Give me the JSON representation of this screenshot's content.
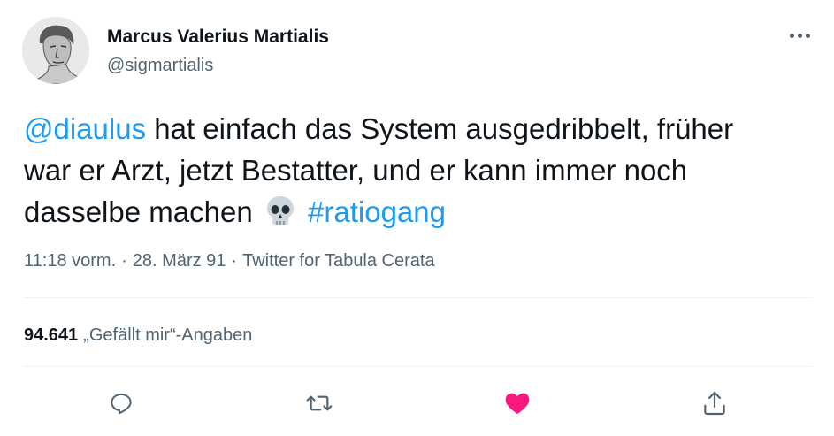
{
  "author": {
    "name": "Marcus Valerius Martialis",
    "handle": "@sigmartialis"
  },
  "tweet": {
    "mention": "@diaulus",
    "text_line1": " hat einfach das System ausgedribbelt, früher",
    "text_line2": "war er Arzt, jetzt Bestatter, und er kann immer noch",
    "text_line3": "dasselbe machen",
    "emoji": "skull-icon",
    "hashtag": "#ratiogang"
  },
  "meta": {
    "time": "11:18 vorm.",
    "date": "28. März 91",
    "source": "Twitter for Tabula Cerata",
    "separator": "·"
  },
  "stats": {
    "likes_count": "94.641",
    "likes_label": "„Gefällt mir“-Angaben"
  },
  "actions": {
    "reply": "reply-icon",
    "retweet": "retweet-icon",
    "like": "heart-icon",
    "share": "share-icon"
  },
  "colors": {
    "accent": "#1d9bf0",
    "like": "#f91880",
    "muted": "#536471",
    "text": "#0f1419"
  }
}
